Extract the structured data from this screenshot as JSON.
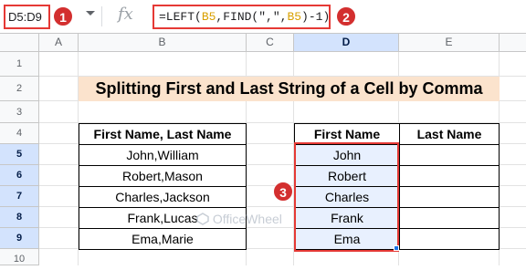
{
  "name_box": "D5:D9",
  "formula": {
    "prefix": "=LEFT(",
    "ref1": "B5",
    "mid": ",FIND(\",\",",
    "ref2": "B5",
    "suffix": ")-1)"
  },
  "fx_label": "fx",
  "badges": [
    "1",
    "2",
    "3"
  ],
  "columns": [
    "A",
    "B",
    "C",
    "D",
    "E"
  ],
  "rows": [
    "1",
    "2",
    "3",
    "4",
    "5",
    "6",
    "7",
    "8",
    "9",
    "10"
  ],
  "title": "Splitting First and Last String of a Cell by Comma",
  "left_table": {
    "header": "First Name, Last Name",
    "values": [
      "John,William",
      "Robert,Mason",
      "Charles,Jackson",
      "Frank,Lucas",
      "Ema,Marie"
    ]
  },
  "right_table": {
    "headers": [
      "First Name",
      "Last Name"
    ],
    "first_names": [
      "John",
      "Robert",
      "Charles",
      "Frank",
      "Ema"
    ],
    "last_names": [
      "",
      "",
      "",
      "",
      ""
    ]
  },
  "watermark": "OfficeWheel",
  "colors": {
    "accent_red": "#e53935",
    "title_bg": "#fbe3cd",
    "selection_bg": "#e8f0fe"
  }
}
